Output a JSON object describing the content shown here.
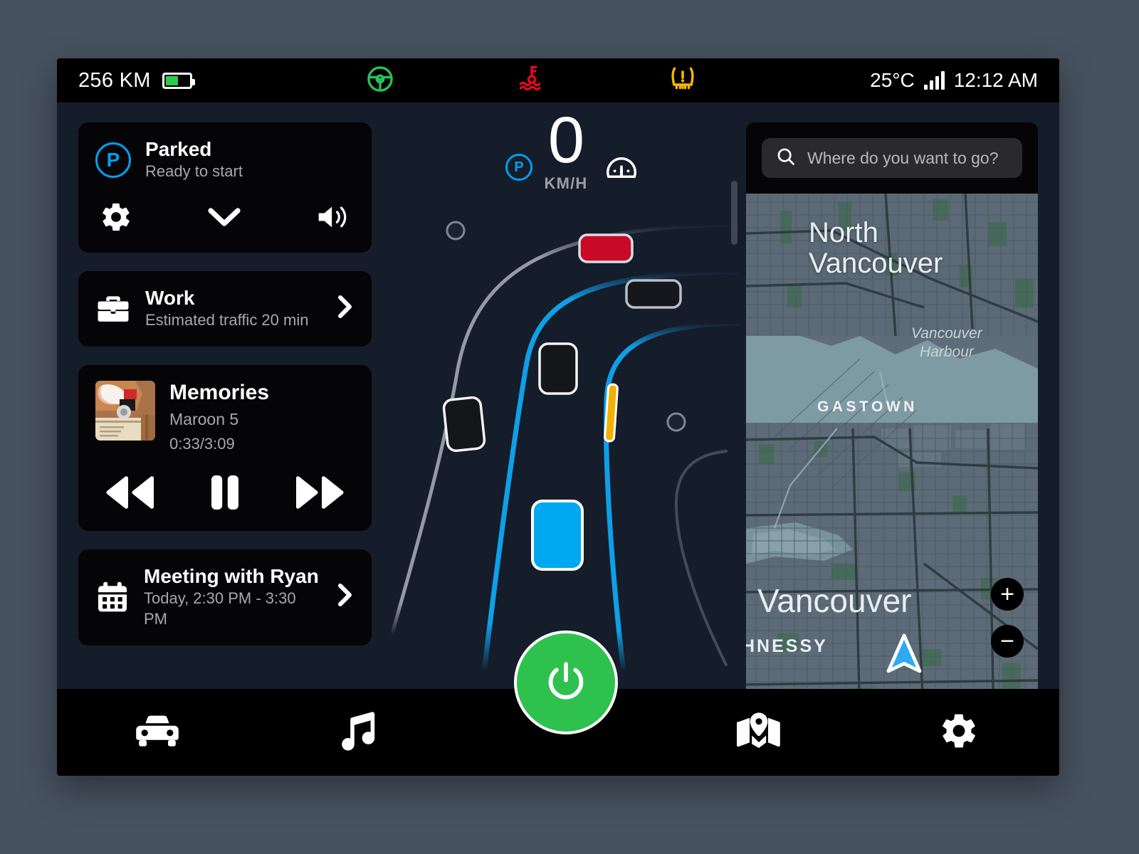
{
  "status_bar": {
    "range": "256 KM",
    "battery_icon": "battery-icon",
    "battery_level_pct": 60,
    "indicators": [
      {
        "name": "steering-wheel-icon",
        "color": "#25c55a",
        "label": "Lane keep assist"
      },
      {
        "name": "coolant-temperature-warning-icon",
        "color": "#e00b1e",
        "label": "Coolant temperature"
      },
      {
        "name": "tire-pressure-warning-icon",
        "color": "#f2b705",
        "label": "Tire pressure"
      }
    ],
    "temperature": "25°C",
    "signal_icon": "signal-bars-icon",
    "signal_bars": 4,
    "time": "12:12 AM"
  },
  "left_panel": {
    "parked_card": {
      "badge": "P",
      "title": "Parked",
      "subtitle": "Ready to start",
      "accent_color": "#00a0f0",
      "actions": [
        {
          "name": "gear-icon",
          "label": "Settings"
        },
        {
          "name": "chevron-down-icon",
          "label": "Expand"
        },
        {
          "name": "volume-icon",
          "label": "Volume"
        }
      ]
    },
    "work_card": {
      "icon": "briefcase-icon",
      "title": "Work",
      "subtitle": "Estimated traffic 20 min",
      "chevron": "›"
    },
    "music_card": {
      "art_name": "album-art",
      "title": "Memories",
      "artist": "Maroon 5",
      "time": "0:33/3:09",
      "elapsed": "0:33",
      "duration": "3:09",
      "controls": [
        {
          "name": "rewind-button",
          "label": "Previous"
        },
        {
          "name": "pause-button",
          "label": "Pause"
        },
        {
          "name": "fast-forward-button",
          "label": "Next"
        }
      ]
    },
    "calendar_card": {
      "icon": "calendar-icon",
      "title": "Meeting with Ryan",
      "subtitle": "Today, 2:30 PM - 3:30 PM",
      "chevron": "›"
    }
  },
  "center_cluster": {
    "speed": "0",
    "speed_unit": "KM/H",
    "gear_badge": "P",
    "gear_color": "#00a0f0",
    "cruise_icon": "speedometer-icon",
    "road_view": {
      "ego_vehicle_color": "#00a8f0",
      "lane_guide_color": "#0f9fe8",
      "lead_vehicle_color": "#c80a26",
      "barrier_color": "#f2b100",
      "vehicles": [
        {
          "name": "lead-vehicle",
          "color": "#c80a26"
        },
        {
          "name": "traffic-vehicle-right",
          "color": "#16181d"
        },
        {
          "name": "traffic-vehicle-center",
          "color": "#16181d"
        },
        {
          "name": "traffic-vehicle-left",
          "color": "#16181d"
        },
        {
          "name": "ego-vehicle",
          "color": "#00a8f0"
        }
      ]
    }
  },
  "map_panel": {
    "search_placeholder": "Where do you want to go?",
    "search_value": "",
    "search_icon": "search-icon",
    "labels": [
      {
        "text": "North",
        "style": "city"
      },
      {
        "text": "Vancouver",
        "style": "city"
      },
      {
        "text": "Vancouver",
        "style": "water"
      },
      {
        "text": "Harbour",
        "style": "water"
      },
      {
        "text": "GASTOWN",
        "style": "neighborhood"
      },
      {
        "text": "Vancouver",
        "style": "city-large"
      },
      {
        "text": "HNESSY",
        "style": "neighborhood-large"
      }
    ],
    "zoom_in": "+",
    "zoom_out": "−",
    "marker": "navigation-arrow-marker"
  },
  "bottom_nav": {
    "items": [
      {
        "name": "nav-car",
        "icon": "car-icon",
        "label": "Car"
      },
      {
        "name": "nav-music",
        "icon": "music-note-icon",
        "label": "Music"
      },
      {
        "name": "nav-power",
        "icon": "power-icon",
        "label": "Power",
        "color": "#2ec14e"
      },
      {
        "name": "nav-maps",
        "icon": "map-pin-icon",
        "label": "Maps"
      },
      {
        "name": "nav-settings",
        "icon": "gear-icon",
        "label": "Settings"
      }
    ]
  }
}
